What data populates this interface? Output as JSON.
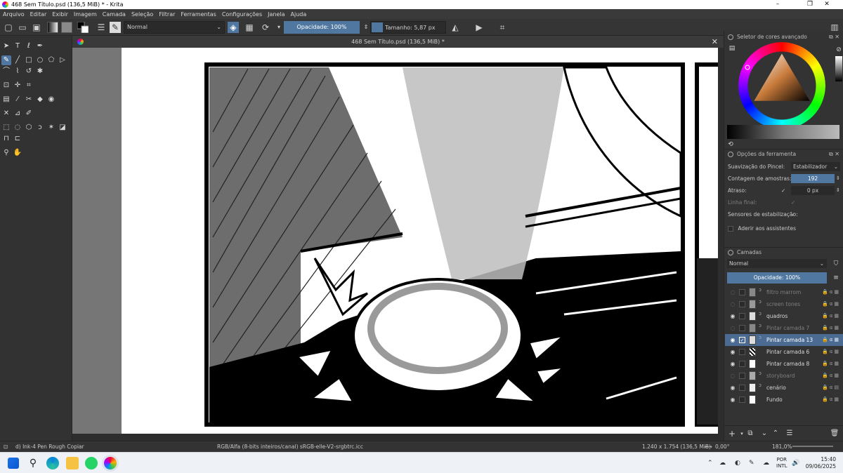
{
  "window": {
    "title": "468 Sem Título.psd (136,5 MiB) * - Krita",
    "controls": {
      "minimize": "–",
      "maximize": "❐",
      "close": "✕"
    }
  },
  "menu": [
    "Arquivo",
    "Editar",
    "Exibir",
    "Imagem",
    "Camada",
    "Seleção",
    "Filtrar",
    "Ferramentas",
    "Configurações",
    "Janela",
    "Ajuda"
  ],
  "toolbar": {
    "blend_mode": "Normal",
    "opacity": "Opacidade: 100%",
    "size": "Tamanho: 5,87 px"
  },
  "document": {
    "tab_title": "468 Sem Título.psd (136,5 MiB) *",
    "close": "✕"
  },
  "color_selector": {
    "title": "Seletor de cores avançado"
  },
  "tool_options": {
    "title": "Opções da ferramenta",
    "smoothing_label": "Suavização do Pincel:",
    "smoothing_value": "Estabilizador",
    "samples_label": "Contagem de amostras:",
    "samples_value": "192",
    "delay_label": "Atraso:",
    "delay_value": "0 px",
    "finish_label": "Linha final:",
    "sensors_label": "Sensores de estabilização:",
    "assistants_label": "Aderir aos assistentes"
  },
  "layers": {
    "title": "Camadas",
    "blend_mode": "Normal",
    "opacity": "Opacidade:  100%",
    "items": [
      {
        "name": "filtro marrom",
        "visible": false,
        "selected": false
      },
      {
        "name": "screen tones",
        "visible": false,
        "selected": false
      },
      {
        "name": "quadros",
        "visible": true,
        "selected": false
      },
      {
        "name": "Pintar camada 7",
        "visible": false,
        "selected": false
      },
      {
        "name": "Pintar camada 13",
        "visible": true,
        "selected": true
      },
      {
        "name": "Pintar camada 6",
        "visible": true,
        "selected": false
      },
      {
        "name": "Pintar camada 8",
        "visible": true,
        "selected": false
      },
      {
        "name": "storyboard",
        "visible": false,
        "selected": false
      },
      {
        "name": "cenário",
        "visible": true,
        "selected": false
      },
      {
        "name": "Fundo",
        "visible": true,
        "selected": false
      }
    ]
  },
  "status": {
    "brush": "d) Ink-4 Pen Rough Copiar",
    "color_space": "RGB/Alfa (8-bits inteiros/canal)  sRGB-elle-V2-srgbtrc.icc",
    "dimensions": "1.240 x 1.754 (136,5 MiB)",
    "rotation": "0,00°",
    "zoom": "181,0%"
  },
  "taskbar": {
    "lang_top": "POR",
    "lang_bottom": "INTL",
    "time": "15:40",
    "date": "09/06/2025"
  }
}
